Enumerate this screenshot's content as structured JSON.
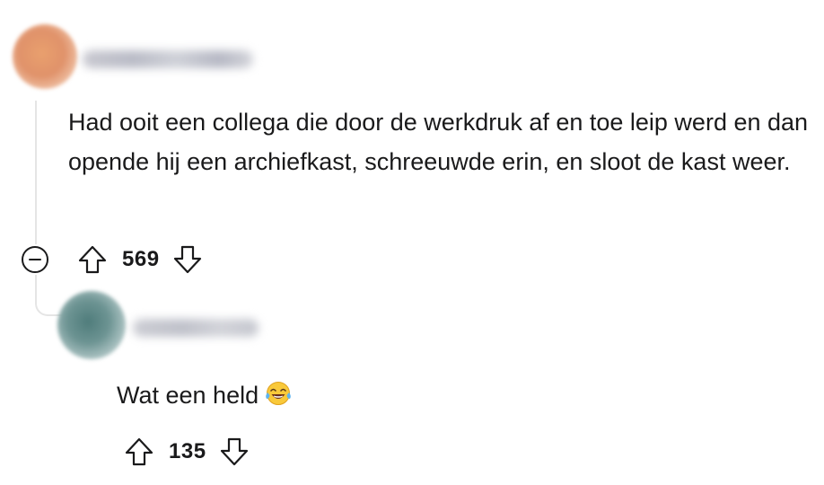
{
  "comment": {
    "username": "",
    "body": "Had ooit een collega die door de werkdruk af en toe leip werd en dan opende hij een archiefkast, schreeuwde erin, en sloot de kast weer.",
    "score": "569",
    "upvote_icon": "arrow-up-icon",
    "downvote_icon": "arrow-down-icon",
    "collapse_icon": "minus-circle-icon"
  },
  "reply": {
    "username": "",
    "body": "Wat een held",
    "emoji": "face-with-tears-of-joy",
    "score": "135",
    "upvote_icon": "arrow-up-icon",
    "downvote_icon": "arrow-down-icon"
  },
  "colors": {
    "text": "#1a1a1b",
    "thread_line": "#e5e5e5",
    "icon_stroke": "#1a1a1b"
  }
}
